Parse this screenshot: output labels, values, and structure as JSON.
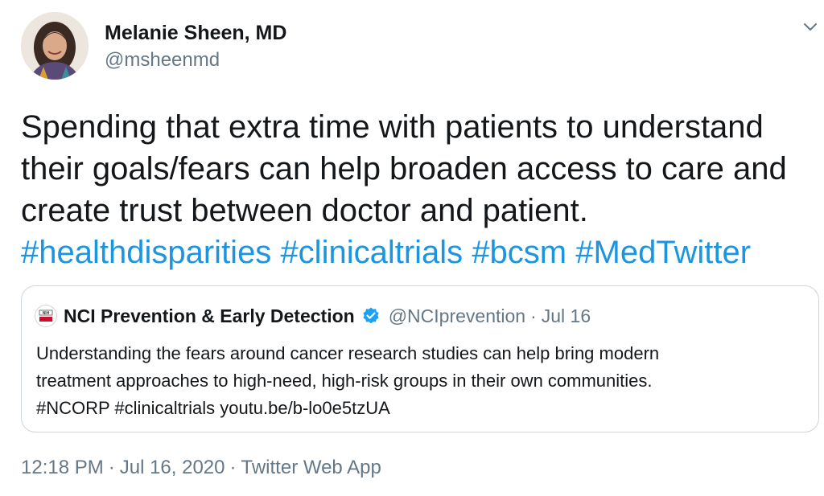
{
  "author": {
    "display_name": "Melanie Sheen, MD",
    "handle": "@msheenmd"
  },
  "tweet": {
    "text_lines": [
      "Spending that extra time with patients to understand",
      "their goals/fears can help broaden access to care and",
      "create trust between doctor and patient."
    ],
    "hashtags": [
      "#healthdisparities",
      "#clinicaltrials",
      "#bcsm",
      "#MedTwitter"
    ]
  },
  "quoted_tweet": {
    "display_name": "NCI Prevention & Early Detection",
    "handle": "@NCIprevention",
    "separator": "·",
    "date": "Jul 16",
    "avatar_logo_text": "NIH",
    "text_lines": [
      "Understanding the fears around cancer research studies can help bring modern",
      "treatment approaches to high-need, high-risk groups in their own communities.",
      "#NCORP #clinicaltrials  youtu.be/b-lo0e5tzUA"
    ]
  },
  "meta": {
    "time": "12:18 PM",
    "separator": "·",
    "date": "Jul 16, 2020",
    "source": "Twitter Web App"
  },
  "icons": {
    "caret": "chevron-down-icon",
    "verified": "verified-badge-icon"
  },
  "colors": {
    "link": "#1b95e0",
    "secondary_text": "#657786",
    "border": "#ccd6dd",
    "verified": "#1da1f2",
    "nih_red": "#c8102e"
  }
}
